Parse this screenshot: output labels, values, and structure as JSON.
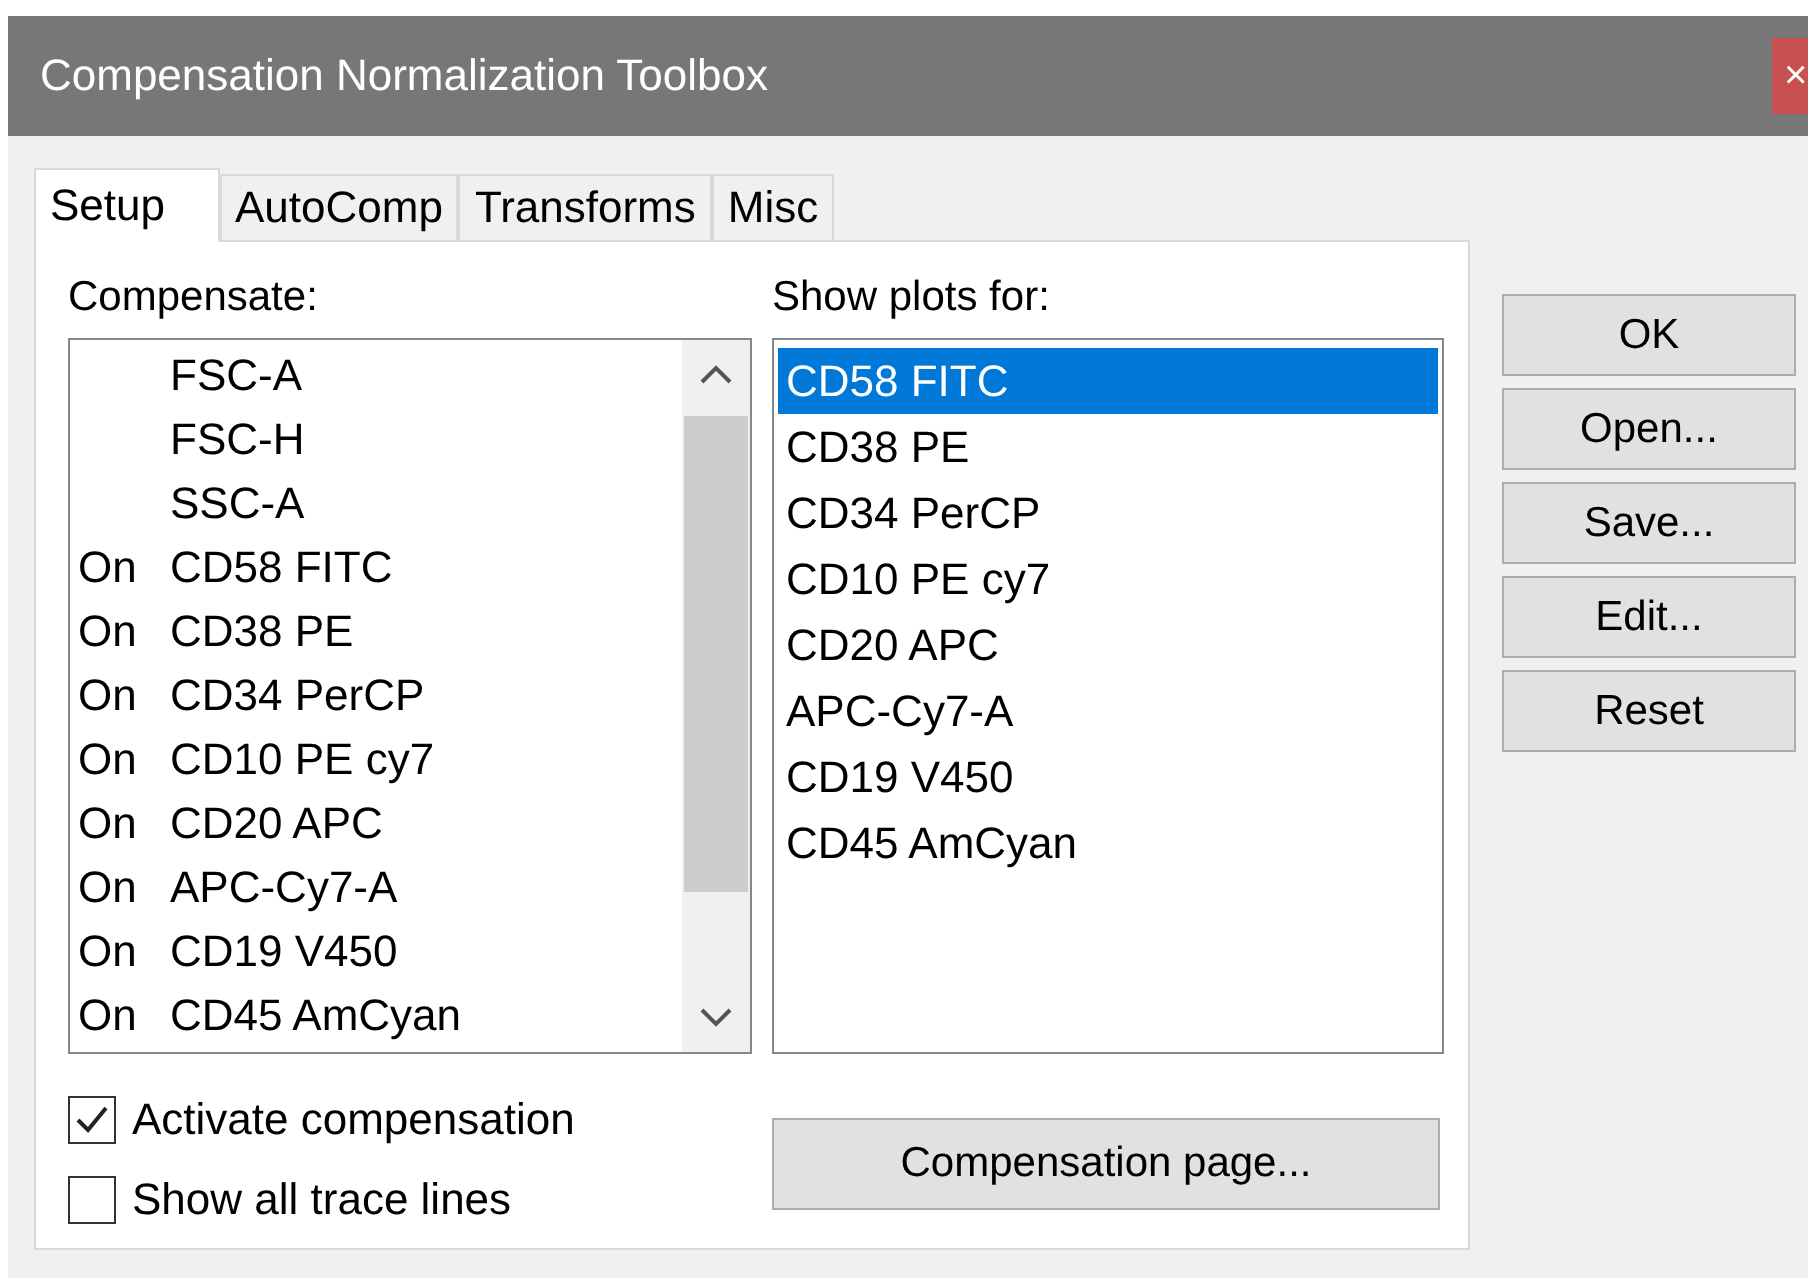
{
  "window": {
    "title": "Compensation Normalization Toolbox",
    "close": "×"
  },
  "tabs": [
    {
      "label": "Setup",
      "selected": true
    },
    {
      "label": "AutoComp",
      "selected": false
    },
    {
      "label": "Transforms",
      "selected": false
    },
    {
      "label": "Misc",
      "selected": false
    }
  ],
  "compensate": {
    "label": "Compensate:",
    "items": [
      {
        "name": "FSC-A"
      },
      {
        "name": "FSC-H"
      },
      {
        "name": "SSC-A"
      },
      {
        "status": "On",
        "name": "CD58 FITC"
      },
      {
        "status": "On",
        "name": "CD38 PE"
      },
      {
        "status": "On",
        "name": "CD34 PerCP"
      },
      {
        "status": "On",
        "name": "CD10 PE cy7"
      },
      {
        "status": "On",
        "name": "CD20 APC"
      },
      {
        "status": "On",
        "name": "APC-Cy7-A"
      },
      {
        "status": "On",
        "name": "CD19 V450"
      },
      {
        "status": "On",
        "name": "CD45 AmCyan"
      }
    ]
  },
  "show_plots": {
    "label": "Show plots for:",
    "items": [
      {
        "name": "CD58 FITC",
        "selected": true
      },
      {
        "name": "CD38 PE",
        "selected": false
      },
      {
        "name": "CD34 PerCP",
        "selected": false
      },
      {
        "name": "CD10 PE cy7",
        "selected": false
      },
      {
        "name": "CD20 APC",
        "selected": false
      },
      {
        "name": "APC-Cy7-A",
        "selected": false
      },
      {
        "name": "CD19 V450",
        "selected": false
      },
      {
        "name": "CD45 AmCyan",
        "selected": false
      }
    ]
  },
  "checkboxes": [
    {
      "label": "Activate compensation",
      "checked": true
    },
    {
      "label": "Show all trace lines",
      "checked": false
    }
  ],
  "compensation_page_button": "Compensation page...",
  "buttons": [
    "OK",
    "Open...",
    "Save...",
    "Edit...",
    "Reset"
  ]
}
